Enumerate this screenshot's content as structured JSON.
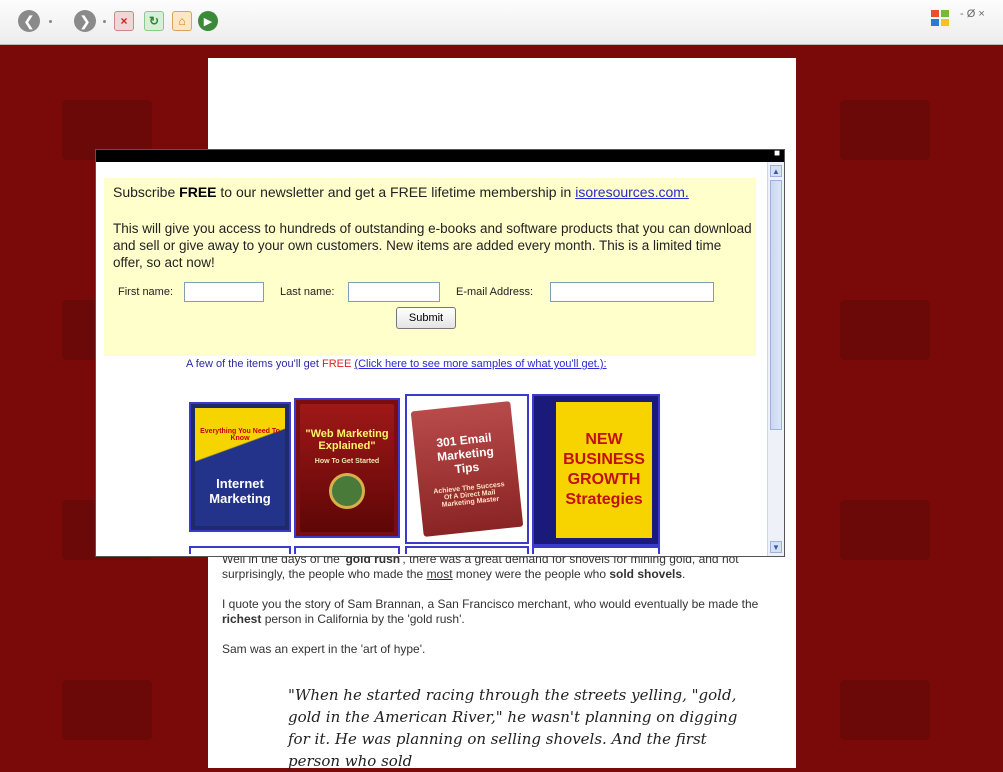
{
  "toolbar": {
    "back_icon": "back-arrow-icon",
    "forward_icon": "forward-arrow-icon",
    "stop_icon": "stop-icon",
    "refresh_icon": "refresh-icon",
    "home_icon": "home-icon",
    "media_icon": "media-icon",
    "window_controls": "- Ø ×"
  },
  "popup": {
    "lead_pre": "Subscribe ",
    "lead_bold": "FREE",
    "lead_post": " to our newsletter and get a FREE lifetime membership in ",
    "lead_link": "isoresources.com.",
    "description": "This will give you access to hundreds of outstanding e-books and software products that you can download and sell or give away to your own customers. New items are added every month. This is a limited time offer, so act now!",
    "form": {
      "first_name_label": "First name:",
      "last_name_label": "Last name:",
      "email_label": "E-mail Address:",
      "submit_label": "Submit"
    },
    "items_text": "A few of the items you'll get ",
    "items_free": "FREE",
    "items_link": "(Click here to see more samples of what you'll get.):",
    "products": [
      {
        "title": "Internet Marketing",
        "tagline": "Everything You Need To Know"
      },
      {
        "title": "\"Web Marketing Explained\"",
        "tagline": "How To Get Started"
      },
      {
        "title": "301 Email Marketing Tips",
        "tagline": "Achieve The Success Of A Direct Mail Marketing Master"
      },
      {
        "title": "NEW BUSINESS GROWTH Strategies",
        "tagline": ""
      }
    ]
  },
  "article": {
    "p1_a": "Well in the days of the '",
    "p1_b": "gold rush",
    "p1_c": "', there was a great demand for shovels for mining gold, and not surprisingly, the people who made the ",
    "p1_d": "most",
    "p1_e": " money were the people who ",
    "p1_f": "sold shovels",
    "p1_g": ".",
    "p2_a": "I quote you the story of Sam Brannan, a San Francisco merchant, who would eventually be made the ",
    "p2_b": "richest",
    "p2_c": " person in California by the 'gold rush'.",
    "p3": "Sam was an expert in the 'art of hype'.",
    "quote": "\"When he started racing through the streets yelling, \"gold, gold in the American River,\" he wasn't planning on digging for it. He was planning on selling shovels. And the first person who sold"
  },
  "colors": {
    "background": "#7a0a0a",
    "popup_panel": "#ffffcc",
    "link": "#2a2ad0",
    "free_red": "#e02020"
  }
}
